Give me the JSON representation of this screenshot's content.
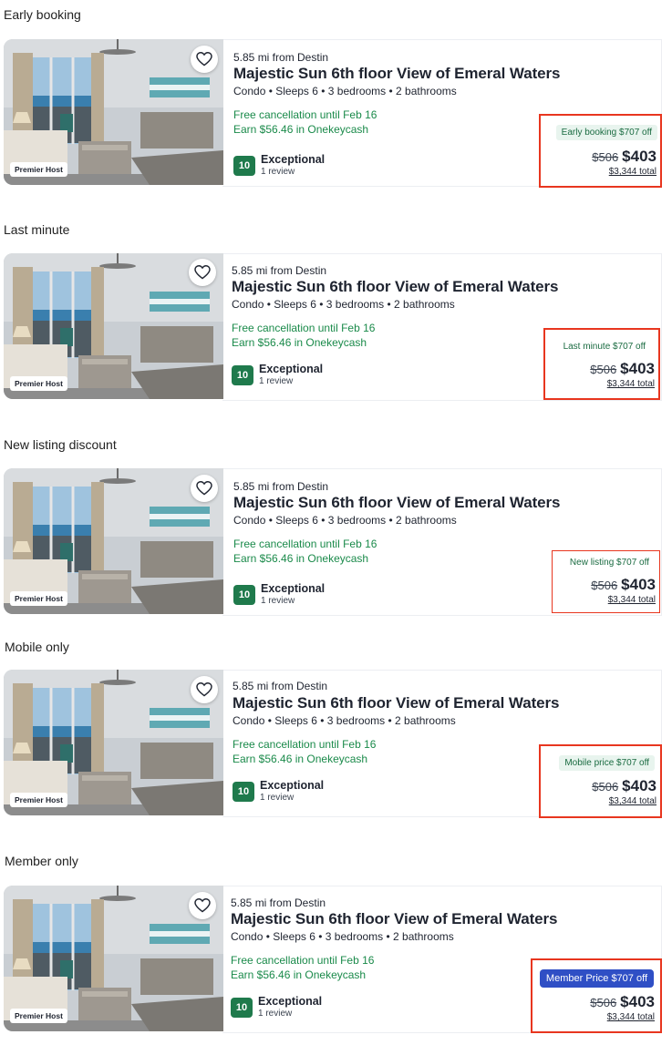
{
  "colors": {
    "green_text": "#1a8a4a",
    "rating_badge": "#1f7a4c",
    "highlight_border": "#e8361f",
    "member_badge": "#2f4fc5"
  },
  "listing": {
    "distance": "5.85 mi from Destin",
    "title": "Majestic Sun 6th floor View of Emeral Waters",
    "meta": "Condo • Sleeps 6 • 3 bedrooms • 2 bathrooms",
    "cancellation": "Free cancellation until Feb 16",
    "earn": "Earn $56.46 in Onekeycash",
    "rating_score": "10",
    "rating_label": "Exceptional",
    "rating_reviews": "1 review",
    "old_price": "$506",
    "new_price": "$403",
    "total": "$3,344 total",
    "premier": "Premier Host",
    "favorite_icon": "heart-icon"
  },
  "sections": [
    {
      "label": "Early booking",
      "deal": "Early booking $707 off"
    },
    {
      "label": "Last minute",
      "deal": "Last minute $707 off"
    },
    {
      "label": "New listing discount",
      "deal": "New listing $707 off"
    },
    {
      "label": "Mobile only",
      "deal": "Mobile price $707 off"
    },
    {
      "label": "Member only",
      "deal": "Member Price $707 off"
    }
  ]
}
